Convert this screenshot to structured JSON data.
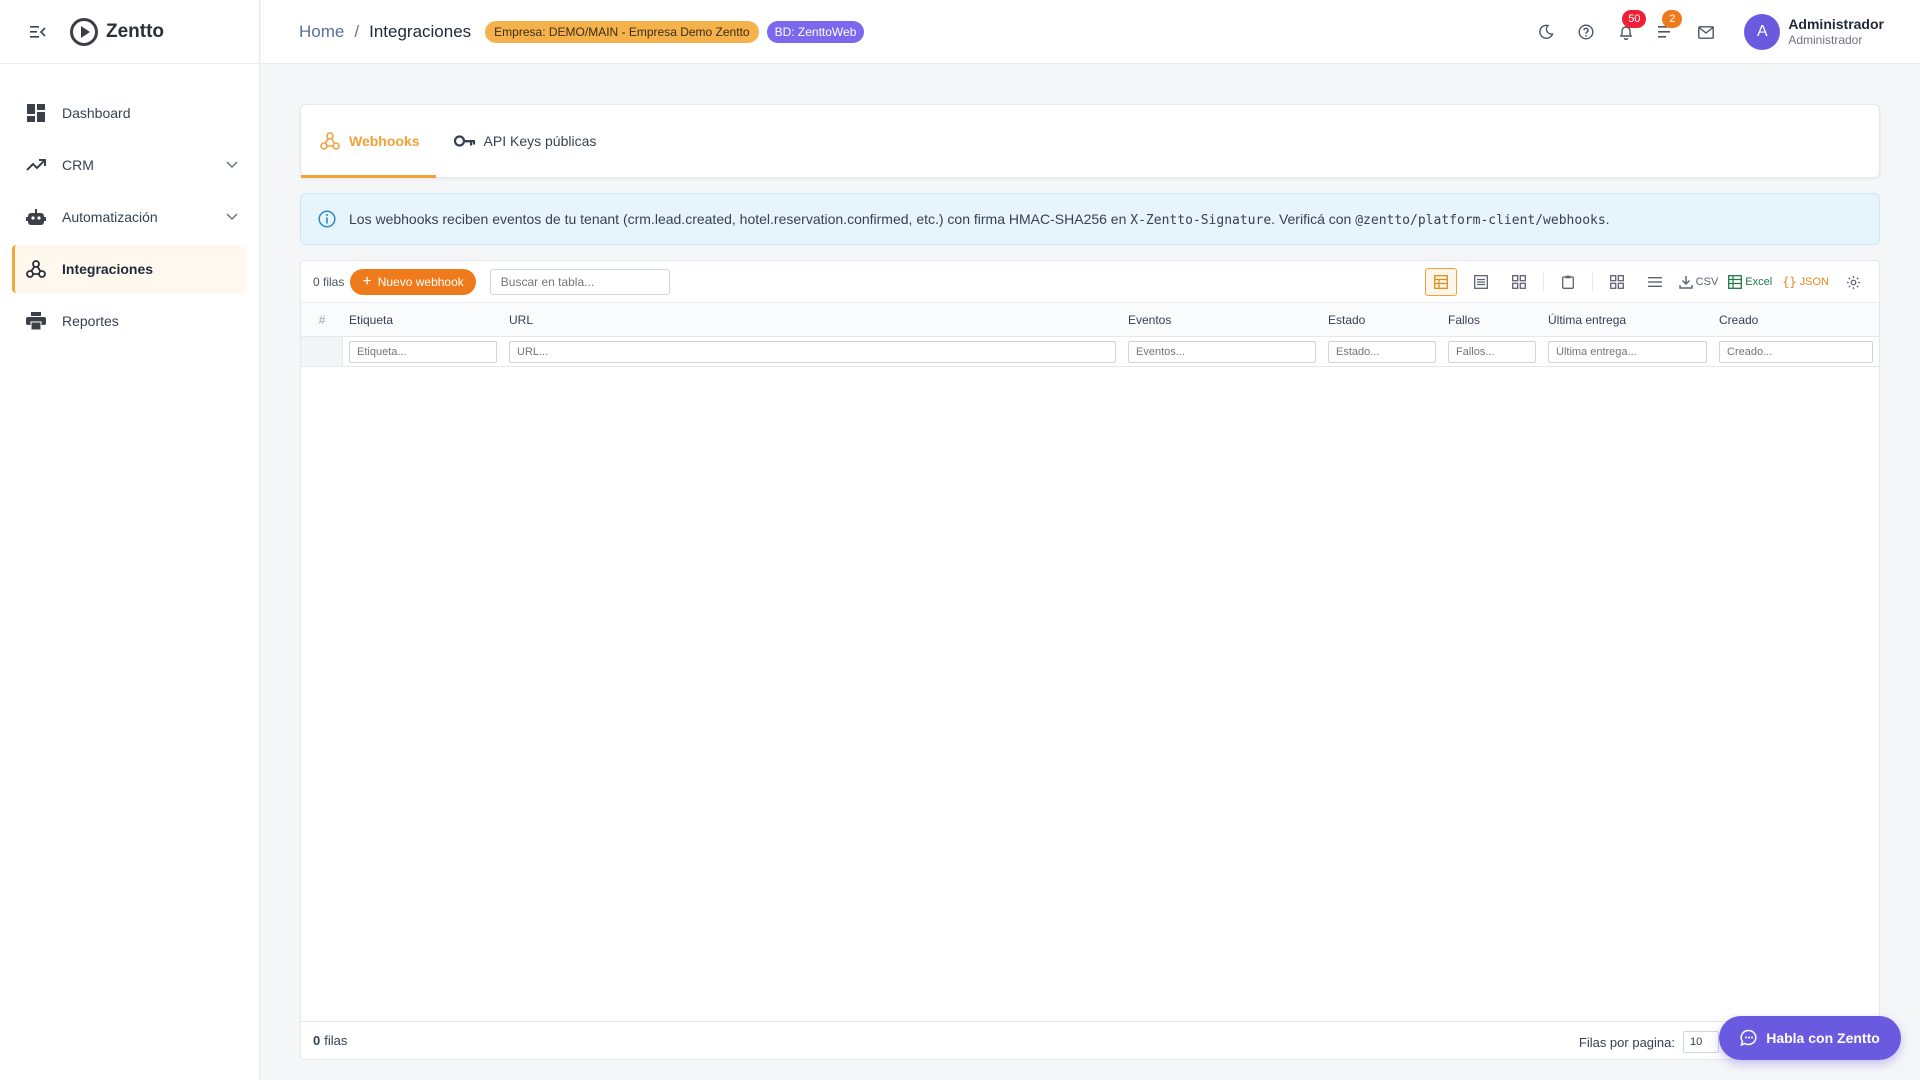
{
  "brand": {
    "name": "Zentto"
  },
  "sidebar": {
    "items": [
      {
        "label": "Dashboard",
        "icon": "dashboard-icon",
        "has_children": false,
        "active": false
      },
      {
        "label": "CRM",
        "icon": "trending-icon",
        "has_children": true,
        "active": false
      },
      {
        "label": "Automatización",
        "icon": "robot-icon",
        "has_children": true,
        "active": false
      },
      {
        "label": "Integraciones",
        "icon": "webhook-icon",
        "has_children": false,
        "active": true
      },
      {
        "label": "Reportes",
        "icon": "printer-icon",
        "has_children": false,
        "active": false
      }
    ]
  },
  "header": {
    "breadcrumb_home": "Home",
    "breadcrumb_sep": "/",
    "breadcrumb_current": "Integraciones",
    "company_badge": "Empresa: DEMO/MAIN - Empresa Demo Zentto",
    "db_badge": "BD: ZenttoWeb",
    "notifications_count": "50",
    "tasks_count": "2",
    "user_initial": "A",
    "user_name": "Administrador",
    "user_role": "Administrador"
  },
  "tabs": [
    {
      "label": "Webhooks",
      "icon": "webhook-icon",
      "active": true
    },
    {
      "label": "API Keys públicas",
      "icon": "key-icon",
      "active": false
    }
  ],
  "info": {
    "text_1": "Los webhooks reciben eventos de tu tenant (crm.lead.created, hotel.reservation.confirmed, etc.) con firma HMAC-SHA256 en ",
    "code_1": "X-Zentto-Signature",
    "text_2": ". Verificá con ",
    "code_2": "@zentto/platform-client/webhooks",
    "text_3": "."
  },
  "grid": {
    "rows_label": "0 filas",
    "new_button": "Nuevo webhook",
    "search_placeholder": "Buscar en tabla...",
    "export_csv": "CSV",
    "export_excel": "Excel",
    "export_json": "JSON",
    "columns": [
      "#",
      "Etiqueta",
      "URL",
      "Eventos",
      "Estado",
      "Fallos",
      "Última entrega",
      "Creado"
    ],
    "filters": [
      "Etiqueta...",
      "URL...",
      "Eventos...",
      "Estado...",
      "Fallos...",
      "Última entrega...",
      "Creado..."
    ],
    "footer_count": "0",
    "footer_label": "filas",
    "per_page_label": "Filas por pagina:",
    "per_page_value": "10"
  },
  "chat": {
    "label": "Habla con Zentto"
  }
}
